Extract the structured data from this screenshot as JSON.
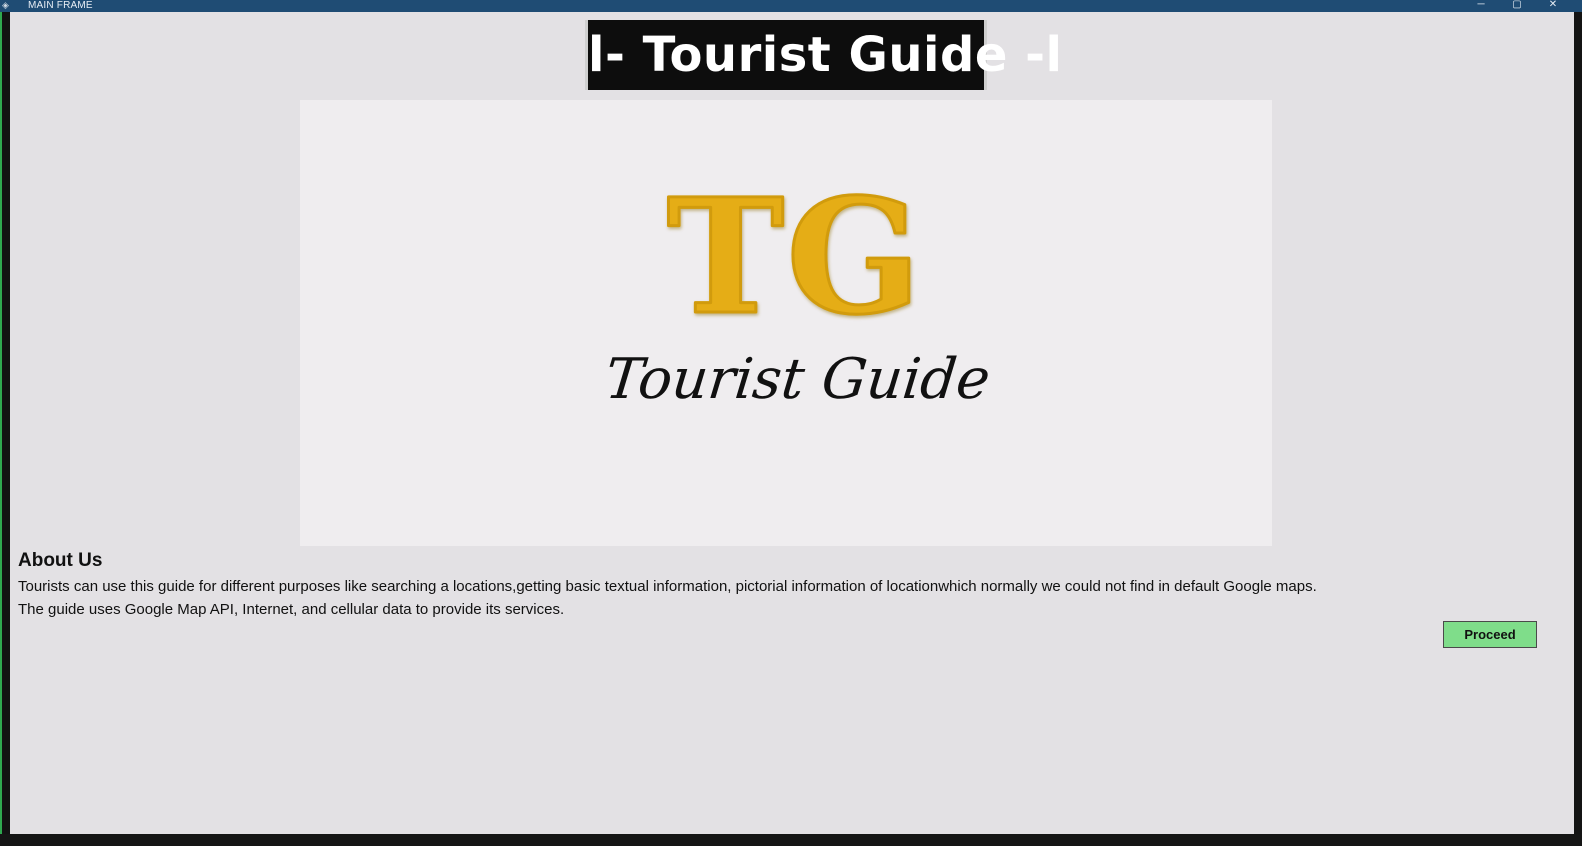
{
  "window": {
    "title": "MAIN FRAME",
    "controls": {
      "minimize": "─",
      "maximize": "▢",
      "close": "✕"
    },
    "icon": "app-icon",
    "titlebar_color": "#1f4c74"
  },
  "header": {
    "title": "l- Tourist Guide -l"
  },
  "logo": {
    "letters": "TG",
    "subtitle": "Tourist Guide",
    "letter_color": "#e5ad13"
  },
  "about": {
    "heading": "About Us",
    "line1": "Tourists can use this guide for different purposes like searching a locations,getting basic textual information, pictorial information of locationwhich normally we could not find in default Google maps.",
    "line2": "The guide uses Google Map API, Internet, and cellular data to provide its services."
  },
  "actions": {
    "proceed_label": "Proceed",
    "proceed_color": "#7fdd8a"
  }
}
